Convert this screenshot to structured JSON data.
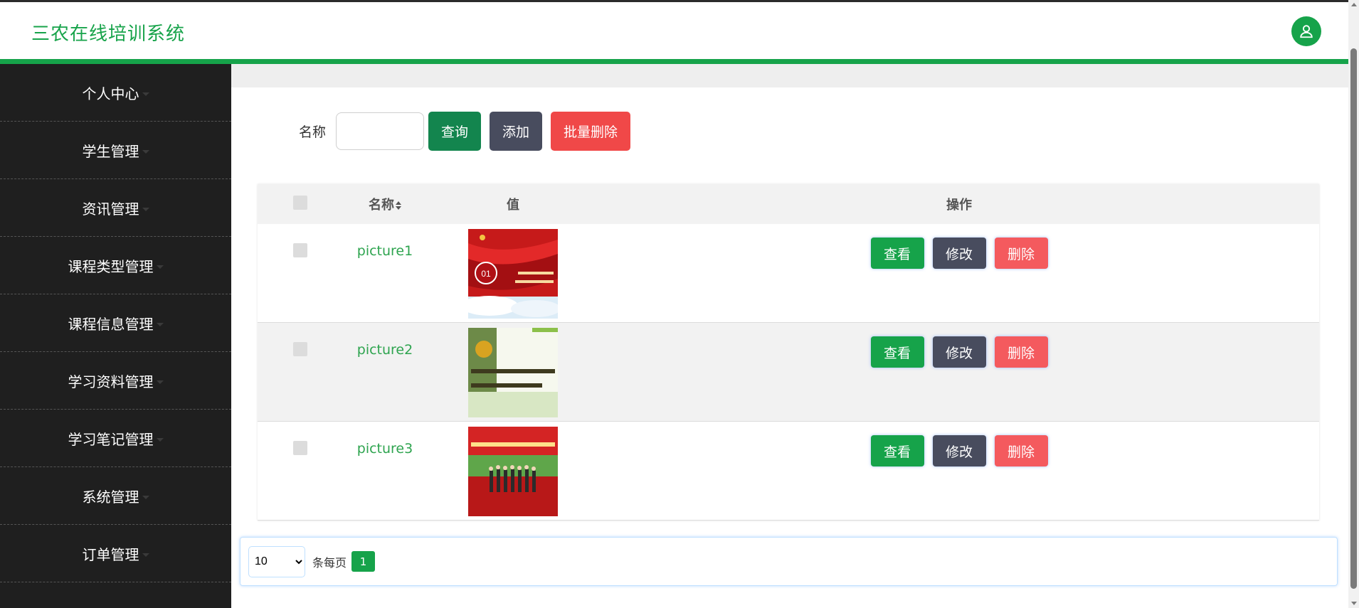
{
  "header": {
    "title": "三农在线培训系统"
  },
  "sidebar": {
    "items": [
      {
        "label": "个人中心"
      },
      {
        "label": "学生管理"
      },
      {
        "label": "资讯管理"
      },
      {
        "label": "课程类型管理"
      },
      {
        "label": "课程信息管理"
      },
      {
        "label": "学习资料管理"
      },
      {
        "label": "学习笔记管理"
      },
      {
        "label": "系统管理"
      },
      {
        "label": "订单管理"
      }
    ]
  },
  "search": {
    "label": "名称",
    "value": "",
    "query_btn": "查询",
    "add_btn": "添加",
    "batch_delete_btn": "批量删除"
  },
  "table": {
    "headers": {
      "name": "名称",
      "value": "值",
      "ops": "操作"
    },
    "rows": [
      {
        "name": "picture1"
      },
      {
        "name": "picture2"
      },
      {
        "name": "picture3"
      }
    ],
    "ops": {
      "view": "查看",
      "edit": "修改",
      "delete": "删除"
    }
  },
  "pager": {
    "page_size": "10",
    "page_size_options": [
      "10"
    ],
    "per_page_label": "条每页",
    "current_page": "1"
  },
  "colors": {
    "accent": "#16a34a",
    "sidebar": "#1f1f1f",
    "danger": "#f04848",
    "dark": "#484c5e"
  }
}
